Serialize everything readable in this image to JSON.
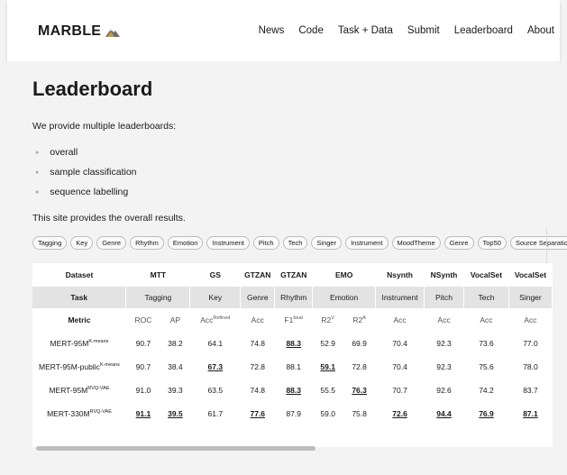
{
  "nav": {
    "brand": "MARBLE",
    "links": [
      "News",
      "Code",
      "Task + Data",
      "Submit",
      "Leaderboard",
      "About"
    ]
  },
  "page": {
    "title": "Leaderboard",
    "intro": "We provide multiple leaderboards:",
    "leaderboards": [
      "overall",
      "sample classification",
      "sequence labelling"
    ],
    "site_note": "This site provides the overall results."
  },
  "tags": [
    "Tagging",
    "Key",
    "Genre",
    "Rhythm",
    "Emotion",
    "Instrument",
    "Pitch",
    "Tech",
    "Singer",
    "Instrument",
    "MoodTheme",
    "Genre",
    "Top50",
    "Source Separation"
  ],
  "table": {
    "datasets": [
      "Dataset",
      "MTT",
      "GS",
      "GTZAN",
      "GTZAN",
      "EMO",
      "Nsynth",
      "NSynth",
      "VocalSet",
      "VocalSet"
    ],
    "tasks": [
      "Task",
      "Tagging",
      "Key",
      "Genre",
      "Rhythm",
      "Emotion",
      "Instrument",
      "Pitch",
      "Tech",
      "Singer"
    ],
    "metrics": [
      {
        "base": "Metric",
        "sup": ""
      },
      {
        "base": "ROC",
        "sup": ""
      },
      {
        "base": "AP",
        "sup": ""
      },
      {
        "base": "Acc",
        "sup": "Refined"
      },
      {
        "base": "Acc",
        "sup": ""
      },
      {
        "base": "F1",
        "sup": "beat"
      },
      {
        "base": "R2",
        "sup": "V"
      },
      {
        "base": "R2",
        "sup": "A"
      },
      {
        "base": "Acc",
        "sup": ""
      },
      {
        "base": "Acc",
        "sup": ""
      },
      {
        "base": "Acc",
        "sup": ""
      },
      {
        "base": "Acc",
        "sup": ""
      }
    ],
    "rows": [
      {
        "model": "MERT-95M",
        "model_sup": "K-means",
        "values": [
          "90.7",
          "38.2",
          "64.1",
          "74.8",
          "88.3",
          "52.9",
          "69.9",
          "70.4",
          "92.3",
          "73.6",
          "77.0"
        ],
        "best": [
          false,
          false,
          false,
          false,
          true,
          false,
          false,
          false,
          false,
          false,
          false
        ]
      },
      {
        "model": "MERT-95M-public",
        "model_sup": "K-means",
        "values": [
          "90.7",
          "38.4",
          "67.3",
          "72.8",
          "88.1",
          "59.1",
          "72.8",
          "70.4",
          "92.3",
          "75.6",
          "78.0"
        ],
        "best": [
          false,
          false,
          true,
          false,
          false,
          true,
          false,
          false,
          false,
          false,
          false
        ]
      },
      {
        "model": "MERT-95M",
        "model_sup": "RVQ-VAE",
        "values": [
          "91.0",
          "39.3",
          "63.5",
          "74.8",
          "88.3",
          "55.5",
          "76.3",
          "70.7",
          "92.6",
          "74.2",
          "83.7"
        ],
        "best": [
          false,
          false,
          false,
          false,
          true,
          false,
          true,
          false,
          false,
          false,
          false
        ]
      },
      {
        "model": "MERT-330M",
        "model_sup": "RVQ-VAE",
        "values": [
          "91.1",
          "39.5",
          "61.7",
          "77.6",
          "87.9",
          "59.0",
          "75.8",
          "72.6",
          "94.4",
          "76.9",
          "87.1"
        ],
        "best": [
          true,
          true,
          false,
          true,
          false,
          false,
          false,
          true,
          true,
          true,
          true
        ]
      }
    ]
  }
}
